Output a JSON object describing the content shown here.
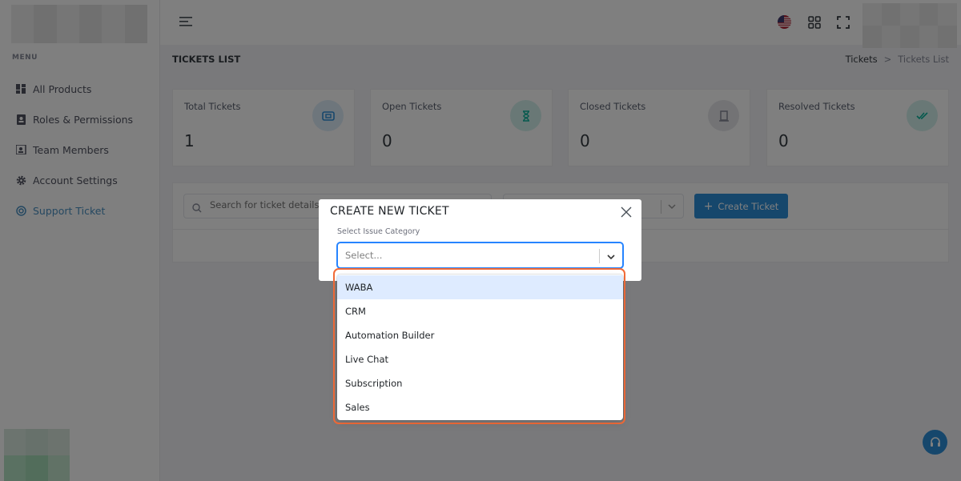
{
  "sidebar": {
    "menu_label": "MENU",
    "items": [
      {
        "label": "All Products",
        "icon": "dashboard-icon"
      },
      {
        "label": "Roles & Permissions",
        "icon": "id-card-icon"
      },
      {
        "label": "Team Members",
        "icon": "contacts-icon"
      },
      {
        "label": "Account Settings",
        "icon": "gear-icon"
      },
      {
        "label": "Support Ticket",
        "icon": "lifebuoy-icon",
        "active": true
      }
    ]
  },
  "header": {
    "page_title": "TICKETS LIST",
    "breadcrumb": [
      "Tickets",
      "Tickets List"
    ],
    "breadcrumb_separator": ">"
  },
  "stats": [
    {
      "label": "Total Tickets",
      "value": "1",
      "icon": "ticket-icon",
      "color": "#2d8ed9"
    },
    {
      "label": "Open Tickets",
      "value": "0",
      "icon": "hourglass-icon",
      "color": "#0ab39c"
    },
    {
      "label": "Closed Tickets",
      "value": "0",
      "icon": "door-icon",
      "color": "#878a99"
    },
    {
      "label": "Resolved Tickets",
      "value": "0",
      "icon": "double-check-icon",
      "color": "#0ab39c"
    }
  ],
  "toolbar": {
    "search_placeholder": "Search for ticket details or something...",
    "create_label": "Create Ticket"
  },
  "modal": {
    "title": "CREATE NEW TICKET",
    "field_label": "Select Issue Category",
    "select_placeholder": "Select...",
    "options": [
      "WABA",
      "CRM",
      "Automation Builder",
      "Live Chat",
      "Subscription",
      "Sales"
    ],
    "focused_option": "WABA"
  },
  "colors": {
    "accent": "#2d8ed9",
    "highlight_ring": "#f26b38",
    "focused_option_bg": "#deebff"
  }
}
